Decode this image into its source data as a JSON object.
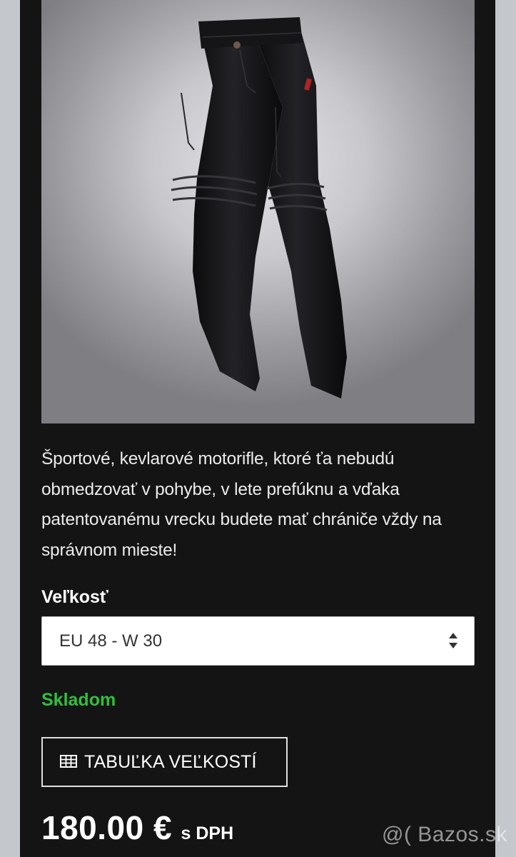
{
  "product": {
    "image_alt": "Black kevlar motorcycle jeans",
    "description": "Športové, kevlarové motorifle, ktoré ťa nebudú obmedzovať v pohybe, v lete prefúknu a vďaka patentovanému vrecku budete mať chrániče vždy na správnom mieste!",
    "size_label": "Veľkosť",
    "selected_size": "EU 48 - W 30",
    "stock_status": "Skladom",
    "size_table_button": "TABUĽKA VEĽKOSTÍ",
    "price": "180.00 €",
    "vat_note": "s DPH"
  },
  "watermark": "@( Bazos.sk",
  "colors": {
    "panel_background": "#141414",
    "page_background": "#c4c7cc",
    "stock_green": "#2fbf3e",
    "text": "#ececec"
  },
  "icons": {
    "select_arrow": "sort-icon",
    "button": "table-icon"
  }
}
